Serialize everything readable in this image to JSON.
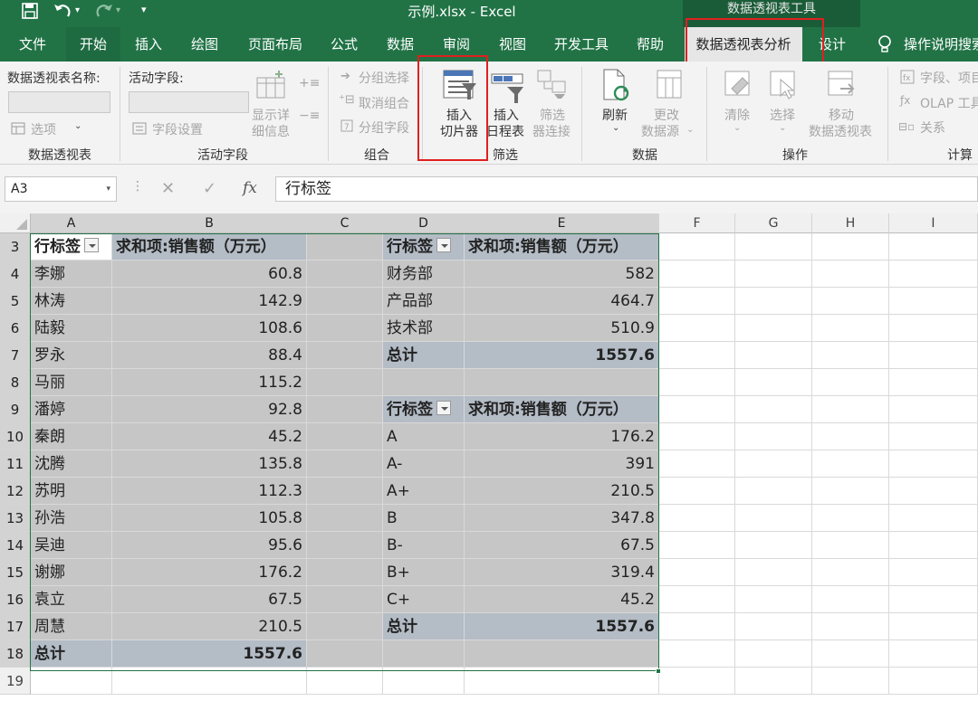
{
  "window": {
    "title": "示例.xlsx  -  Excel",
    "context_header": "数据透视表工具"
  },
  "tabs": [
    "文件",
    "开始",
    "插入",
    "绘图",
    "页面布局",
    "公式",
    "数据",
    "审阅",
    "视图",
    "开发工具",
    "帮助",
    "数据透视表分析",
    "设计"
  ],
  "tell_me": "操作说明搜索",
  "ribbon": {
    "pt_name_label": "数据透视表名称:",
    "options_label": "选项",
    "group_pivottable": "数据透视表",
    "active_field_label": "活动字段:",
    "field_settings": "字段设置",
    "drill_down": "显示详细信息",
    "drill_down_l1": "显示详",
    "drill_down_l2": "细信息",
    "group_active_field": "活动字段",
    "group_selection": "分组选择",
    "ungroup": "取消组合",
    "group_field": "分组字段",
    "group_group": "组合",
    "insert_slicer_l1": "插入",
    "insert_slicer_l2": "切片器",
    "insert_timeline_l1": "插入",
    "insert_timeline_l2": "日程表",
    "filter_conn_l1": "筛选",
    "filter_conn_l2": "器连接",
    "group_filter": "筛选",
    "refresh": "刷新",
    "change_src_l1": "更改",
    "change_src_l2": "数据源",
    "group_data": "数据",
    "clear": "清除",
    "select": "选择",
    "move_l1": "移动",
    "move_l2": "数据透视表",
    "group_actions": "操作",
    "fields_items": "字段、项目",
    "olap_tools": "OLAP 工具",
    "relationships": "关系",
    "group_calc": "计算"
  },
  "formula_bar": {
    "name_box": "A3",
    "fx": "fx",
    "content": "行标签"
  },
  "columns": [
    "A",
    "B",
    "C",
    "D",
    "E",
    "F",
    "G",
    "H",
    "I"
  ],
  "rows": [
    "3",
    "4",
    "5",
    "6",
    "7",
    "8",
    "9",
    "10",
    "11",
    "12",
    "13",
    "14",
    "15",
    "16",
    "17",
    "18",
    "19"
  ],
  "pivot1": {
    "header_label": "行标签",
    "header_value": "求和项:销售额（万元）",
    "rows": [
      {
        "label": "李娜",
        "value": "60.8"
      },
      {
        "label": "林涛",
        "value": "142.9"
      },
      {
        "label": "陆毅",
        "value": "108.6"
      },
      {
        "label": "罗永",
        "value": "88.4"
      },
      {
        "label": "马丽",
        "value": "115.2"
      },
      {
        "label": "潘婷",
        "value": "92.8"
      },
      {
        "label": "秦朗",
        "value": "45.2"
      },
      {
        "label": "沈腾",
        "value": "135.8"
      },
      {
        "label": "苏明",
        "value": "112.3"
      },
      {
        "label": "孙浩",
        "value": "105.8"
      },
      {
        "label": "吴迪",
        "value": "95.6"
      },
      {
        "label": "谢娜",
        "value": "176.2"
      },
      {
        "label": "袁立",
        "value": "67.5"
      },
      {
        "label": "周慧",
        "value": "210.5"
      }
    ],
    "total_label": "总计",
    "total_value": "1557.6"
  },
  "pivot2": {
    "header_label": "行标签",
    "header_value": "求和项:销售额（万元）",
    "rows": [
      {
        "label": "财务部",
        "value": "582"
      },
      {
        "label": "产品部",
        "value": "464.7"
      },
      {
        "label": "技术部",
        "value": "510.9"
      }
    ],
    "total_label": "总计",
    "total_value": "1557.6"
  },
  "pivot3": {
    "header_label": "行标签",
    "header_value": "求和项:销售额（万元）",
    "rows": [
      {
        "label": "A",
        "value": "176.2"
      },
      {
        "label": "A-",
        "value": "391"
      },
      {
        "label": "A+",
        "value": "210.5"
      },
      {
        "label": "B",
        "value": "347.8"
      },
      {
        "label": "B-",
        "value": "67.5"
      },
      {
        "label": "B+",
        "value": "319.4"
      },
      {
        "label": "C+",
        "value": "45.2"
      }
    ],
    "total_label": "总计",
    "total_value": "1557.6"
  },
  "colors": {
    "excel_green": "#217346",
    "pivot_header": "#b4bcc6",
    "pivot_body": "#c6c6c6",
    "highlight_red": "#e02020"
  }
}
